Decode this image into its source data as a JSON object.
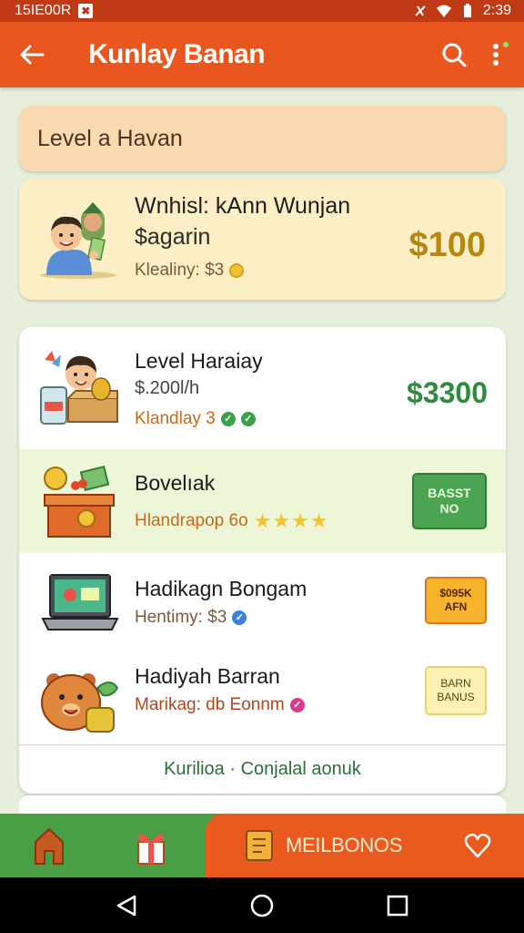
{
  "status_bar": {
    "left_text": "15IE00R",
    "notification_glyph": "✖",
    "time": "2:39"
  },
  "app_bar": {
    "title": "Kunlay Banan",
    "back_icon": "arrow-left-icon",
    "search_icon": "search-icon",
    "more_icon": "more-vertical-icon"
  },
  "level_header": {
    "label": "Level a Havan"
  },
  "featured": {
    "title": "Wnhisl: kAnn Wunjan",
    "subtitle": "$agarin",
    "meta": "Klealiny: $3",
    "amount": "$100"
  },
  "offers": [
    {
      "title": "Level Haraiay",
      "subtitle": "$.200l/h",
      "meta": "Klandlay 3",
      "amount": "$3300"
    },
    {
      "title": "Bovelıak",
      "meta": "Hlandrapop 6o",
      "stars": "★★★★",
      "rating": 4,
      "badge_line1": "BASST",
      "badge_line2": "NO"
    },
    {
      "title": "Hadikagn Bongam",
      "meta": "Hentimy: $3",
      "badge_line1": "$095K",
      "badge_line2": "AFN"
    },
    {
      "title": "Hadiyah Barran",
      "meta": "Marikag: db Eonnm",
      "badge_line1": "BARN",
      "badge_line2": "BANUS"
    }
  ],
  "more_link": "Kurilioa · Conjalal aonuk",
  "bottom_nav": {
    "active_label": "MEILBONOS"
  },
  "colors": {
    "status_bar": "#c03a16",
    "app_bar": "#e9561e",
    "nav_green": "#4a9e45",
    "accent_amount_gold": "#b8870f",
    "accent_amount_green": "#2f8b3e"
  }
}
